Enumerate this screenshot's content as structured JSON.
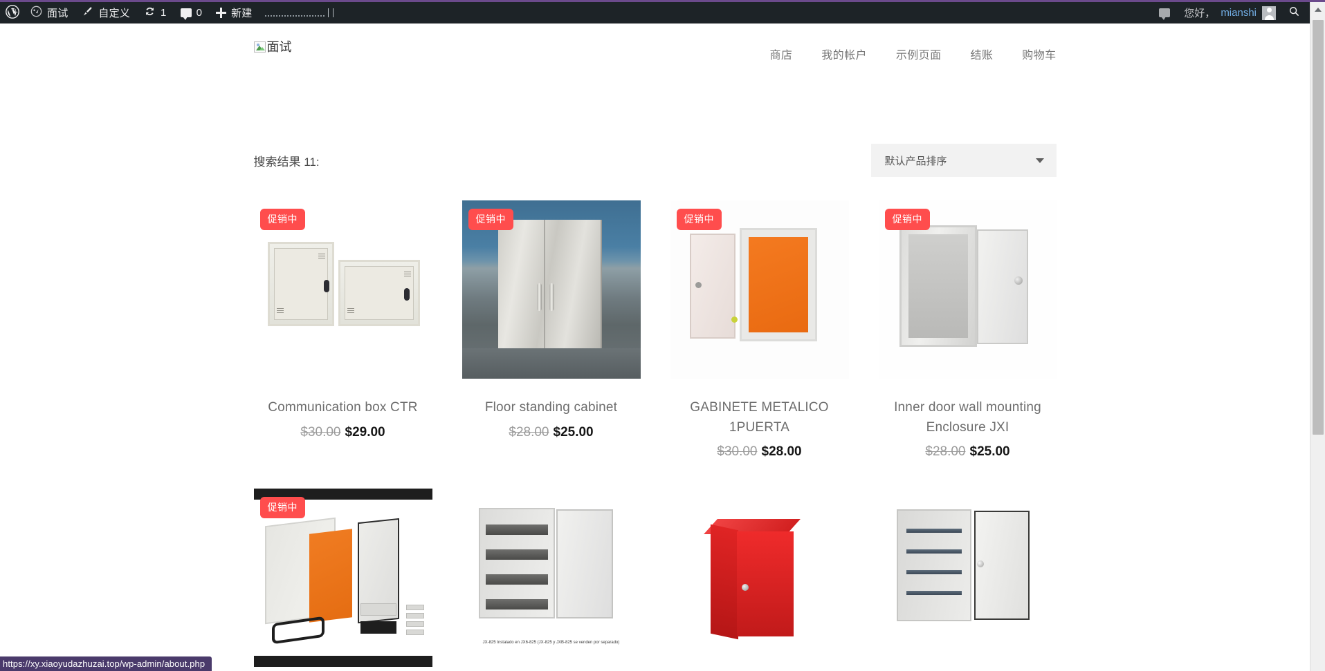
{
  "browser": {
    "status_url": "https://xy.xiaoyudazhuzai.top/wp-admin/about.php",
    "accent": "#4a3a6b"
  },
  "adminbar": {
    "background": "#1d2327",
    "wp_logo": "wordpress-logo-icon",
    "site_name": "面试",
    "site_icon": "dashboard-icon",
    "customize_label": "自定义",
    "customize_icon": "paintbrush-icon",
    "updates_icon": "updates-icon",
    "updates_count": "1",
    "comments_icon": "comment-bubble-icon",
    "comments_count": "0",
    "new_icon": "plus-icon",
    "new_label": "新建",
    "howdy_greeting": "您好，",
    "user_name": "mianshi",
    "avatar_icon": "avatar-icon",
    "search_icon": "search-icon"
  },
  "site": {
    "logo_alt": "面试",
    "nav": [
      {
        "label": "商店"
      },
      {
        "label": "我的帐户"
      },
      {
        "label": "示例页面"
      },
      {
        "label": "结账"
      },
      {
        "label": "购物车"
      }
    ]
  },
  "shop": {
    "results_title": "搜索结果 11:",
    "sort_value": "默认产品排序",
    "sort_icon": "chevron-down-icon",
    "sale_badge_color": "#ff4d4d",
    "products": [
      {
        "badge": "促销中",
        "title": "Communication box CTR",
        "price_old": "$30.00",
        "price_new": "$29.00"
      },
      {
        "badge": "促销中",
        "title": "Floor standing cabinet",
        "price_old": "$28.00",
        "price_new": "$25.00"
      },
      {
        "badge": "促销中",
        "title": "GABINETE METALICO 1PUERTA",
        "price_old": "$30.00",
        "price_new": "$28.00"
      },
      {
        "badge": "促销中",
        "title": "Inner door wall mounting Enclosure JXI",
        "price_old": "$28.00",
        "price_new": "$25.00"
      },
      {
        "badge": "促销中",
        "title": "",
        "price_old": "",
        "price_new": ""
      },
      {
        "badge": "",
        "title": "",
        "price_old": "",
        "price_new": "",
        "image_caption": "JX-825 Instalado en JX6-825  (JX-825 y JXB-825 se venden por separado)"
      },
      {
        "badge": "",
        "title": "",
        "price_old": "",
        "price_new": ""
      },
      {
        "badge": "",
        "title": "",
        "price_old": "",
        "price_new": ""
      }
    ]
  }
}
